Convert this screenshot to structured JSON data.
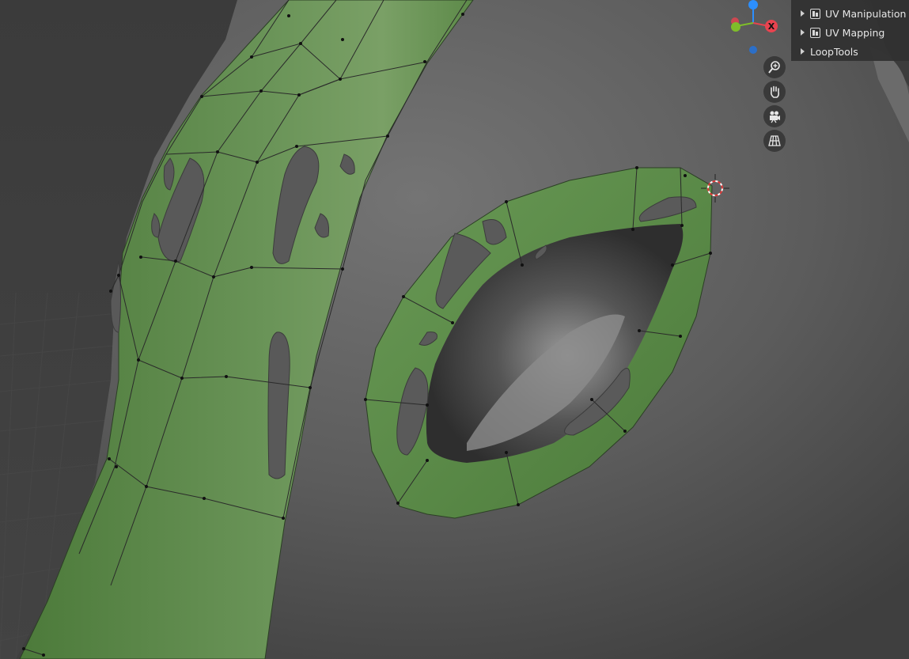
{
  "sidebar": {
    "panels": [
      {
        "label": "UV Manipulation",
        "icon": "uv-editor-icon"
      },
      {
        "label": "UV Mapping",
        "icon": "uv-editor-icon"
      },
      {
        "label": "LoopTools",
        "icon": ""
      }
    ]
  },
  "gizmo": {
    "x_axis_label": "X",
    "x_color": "#e8434f",
    "y_color": "#7fbd2a",
    "z_color": "#2c8fff"
  },
  "nav_buttons": [
    {
      "name": "zoom-button",
      "icon": "zoom-icon"
    },
    {
      "name": "pan-button",
      "icon": "hand-icon"
    },
    {
      "name": "camera-view-button",
      "icon": "camera-icon"
    },
    {
      "name": "perspective-toggle-button",
      "icon": "grid-icon"
    }
  ],
  "colors": {
    "viewport_bg": "#3d3d3d",
    "face_selection": "#5e8c4a",
    "mesh_surface": "#5a5a5a",
    "vertex": "#111111"
  }
}
